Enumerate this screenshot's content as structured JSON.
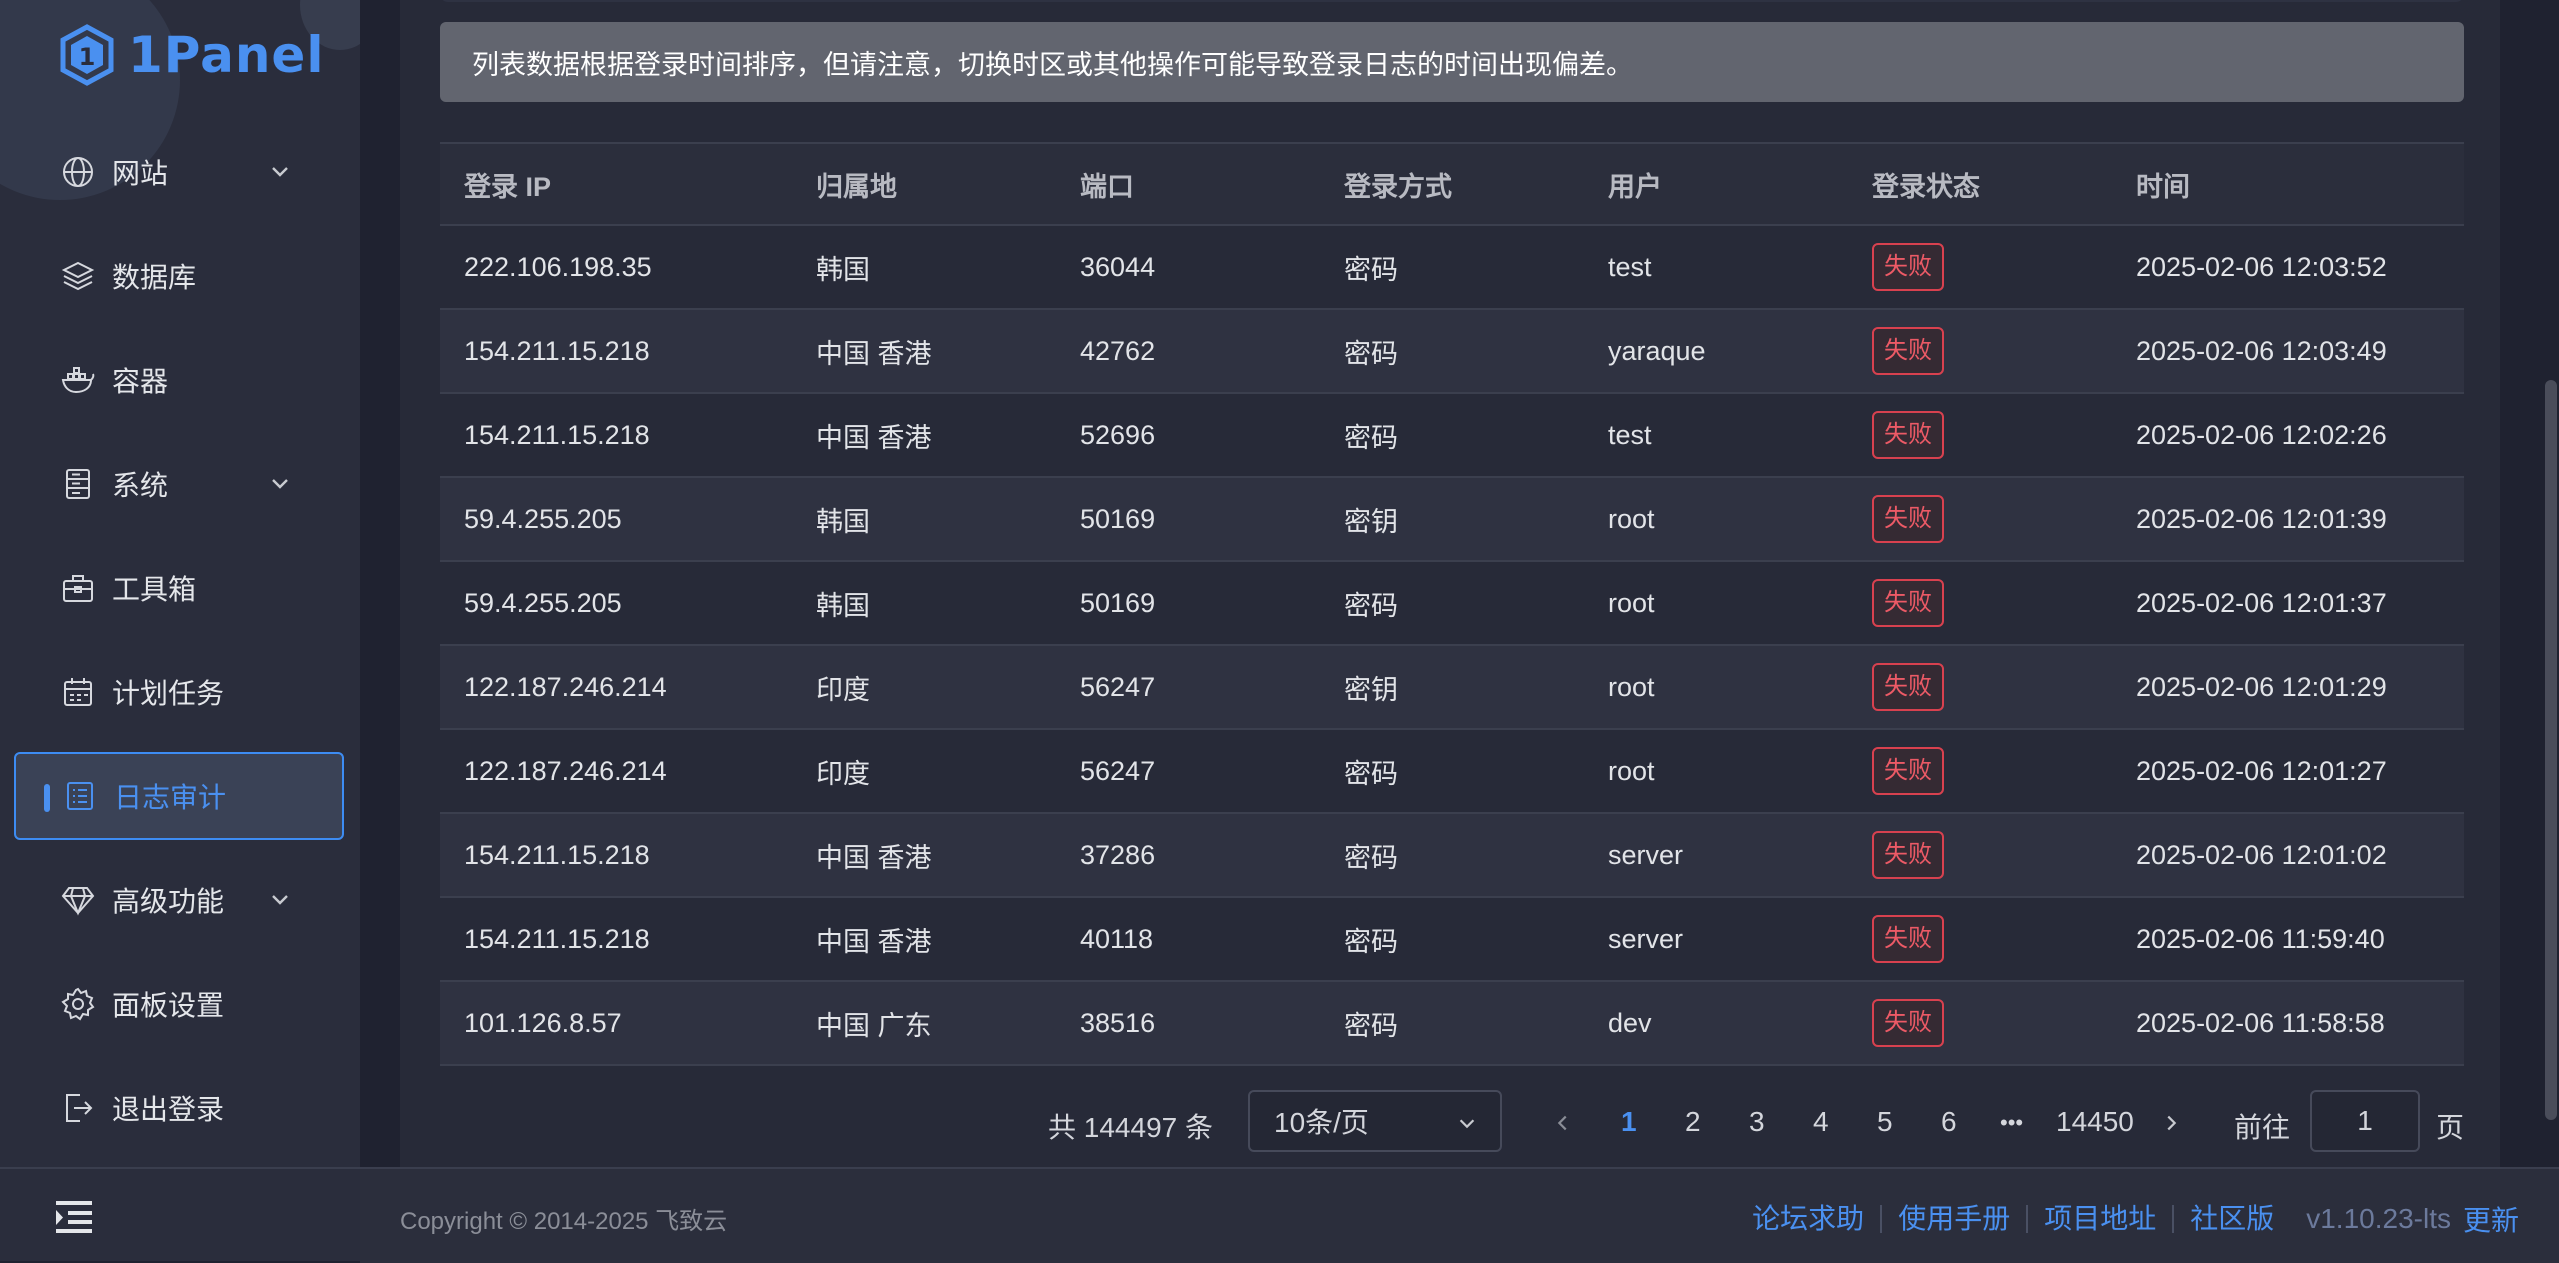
{
  "sidebar": {
    "logo_text": "1Panel",
    "items": [
      {
        "label": "网站",
        "icon": "globe-icon",
        "has_sub": true
      },
      {
        "label": "数据库",
        "icon": "layers-icon",
        "has_sub": false
      },
      {
        "label": "容器",
        "icon": "docker-icon",
        "has_sub": false
      },
      {
        "label": "系统",
        "icon": "server-icon",
        "has_sub": true
      },
      {
        "label": "工具箱",
        "icon": "toolbox-icon",
        "has_sub": false
      },
      {
        "label": "计划任务",
        "icon": "calendar-icon",
        "has_sub": false
      },
      {
        "label": "日志审计",
        "icon": "log-icon",
        "has_sub": false,
        "active": true
      },
      {
        "label": "高级功能",
        "icon": "diamond-icon",
        "has_sub": true
      },
      {
        "label": "面板设置",
        "icon": "gear-icon",
        "has_sub": false
      },
      {
        "label": "退出登录",
        "icon": "logout-icon",
        "has_sub": false
      }
    ]
  },
  "notice": "列表数据根据登录时间排序，但请注意，切换时区或其他操作可能导致登录日志的时间出现偏差。",
  "table": {
    "headers": [
      "登录 IP",
      "归属地",
      "端口",
      "登录方式",
      "用户",
      "登录状态",
      "时间"
    ],
    "rows": [
      [
        "222.106.198.35",
        "韩国",
        "36044",
        "密码",
        "test",
        "失败",
        "2025-02-06 12:03:52"
      ],
      [
        "154.211.15.218",
        "中国 香港",
        "42762",
        "密码",
        "yaraque",
        "失败",
        "2025-02-06 12:03:49"
      ],
      [
        "154.211.15.218",
        "中国 香港",
        "52696",
        "密码",
        "test",
        "失败",
        "2025-02-06 12:02:26"
      ],
      [
        "59.4.255.205",
        "韩国",
        "50169",
        "密钥",
        "root",
        "失败",
        "2025-02-06 12:01:39"
      ],
      [
        "59.4.255.205",
        "韩国",
        "50169",
        "密码",
        "root",
        "失败",
        "2025-02-06 12:01:37"
      ],
      [
        "122.187.246.214",
        "印度",
        "56247",
        "密钥",
        "root",
        "失败",
        "2025-02-06 12:01:29"
      ],
      [
        "122.187.246.214",
        "印度",
        "56247",
        "密码",
        "root",
        "失败",
        "2025-02-06 12:01:27"
      ],
      [
        "154.211.15.218",
        "中国 香港",
        "37286",
        "密码",
        "server",
        "失败",
        "2025-02-06 12:01:02"
      ],
      [
        "154.211.15.218",
        "中国 香港",
        "40118",
        "密码",
        "server",
        "失败",
        "2025-02-06 11:59:40"
      ],
      [
        "101.126.8.57",
        "中国 广东",
        "38516",
        "密码",
        "dev",
        "失败",
        "2025-02-06 11:58:58"
      ]
    ]
  },
  "pagination": {
    "total": "共 144497 条",
    "page_size": "10条/页",
    "pages": [
      "1",
      "2",
      "3",
      "4",
      "5",
      "6"
    ],
    "ellipsis": "•••",
    "last_page": "14450",
    "current": "1",
    "goto_label": "前往",
    "goto_value": "1",
    "goto_unit": "页"
  },
  "footer": {
    "copyright": "Copyright © 2014-2025 飞致云",
    "links": [
      "论坛求助",
      "使用手册",
      "项目地址",
      "社区版"
    ],
    "version": "v1.10.23-lts",
    "update": "更新"
  },
  "colors": {
    "accent": "#4a90f0",
    "fail": "#ec5a66",
    "sidebar_bg": "#2a2d3c",
    "main_bg": "#272a38"
  }
}
